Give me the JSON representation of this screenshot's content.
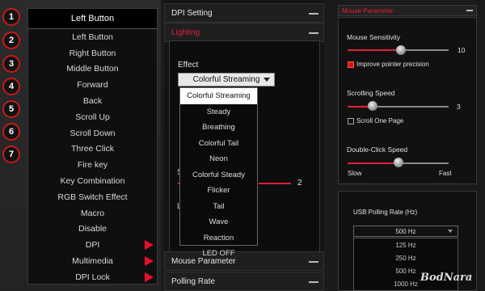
{
  "left": {
    "header": "Left Button",
    "badges": [
      "1",
      "2",
      "3",
      "4",
      "5",
      "6",
      "7"
    ],
    "options": [
      "Left Button",
      "Right Button",
      "Middle Button",
      "Forward",
      "Back",
      "Scroll Up",
      "Scroll Down",
      "Three Click",
      "Fire key",
      "Key Combination",
      "RGB Switch Effect",
      "Macro",
      "Disable",
      "DPI",
      "Multimedia",
      "DPI Lock"
    ]
  },
  "middle": {
    "dpi_setting": "DPI Setting",
    "lighting": "Lighting",
    "effect_label": "Effect",
    "effect_selected": "Colorful Streaming",
    "effect_options": [
      "Colorful Streaming",
      "Steady",
      "Breathing",
      "Colorful Tail",
      "Neon",
      "Colorful Steady",
      "Flicker",
      "Tail",
      "Wave",
      "Reaction",
      "LED OFF"
    ],
    "slider_value": "2",
    "partial_s": "S",
    "partial_l": "L",
    "mouse_parameter": "Mouse Parameter",
    "polling_rate": "Polling Rate"
  },
  "right": {
    "mouse_parameter": "Mouse Parameter",
    "sensitivity_label": "Mouse Sensitivity",
    "sensitivity_value": "10",
    "improve_precision": "Improve pointer precision",
    "scroll_speed_label": "Scrolling Speed",
    "scroll_speed_value": "3",
    "scroll_one_page": "Scroll One Page",
    "double_click_label": "Double-Click Speed",
    "slow": "Slow",
    "fast": "Fast",
    "usb_label": "USB Polling Rate  (Hz)",
    "usb_selected": "500 Hz",
    "usb_options": [
      "125 Hz",
      "250 Hz",
      "500 Hz",
      "1000 Hz"
    ]
  },
  "watermark": "BodNara",
  "colors": {
    "accent_red": "#e0203a",
    "badge_border": "#c81a1a"
  }
}
